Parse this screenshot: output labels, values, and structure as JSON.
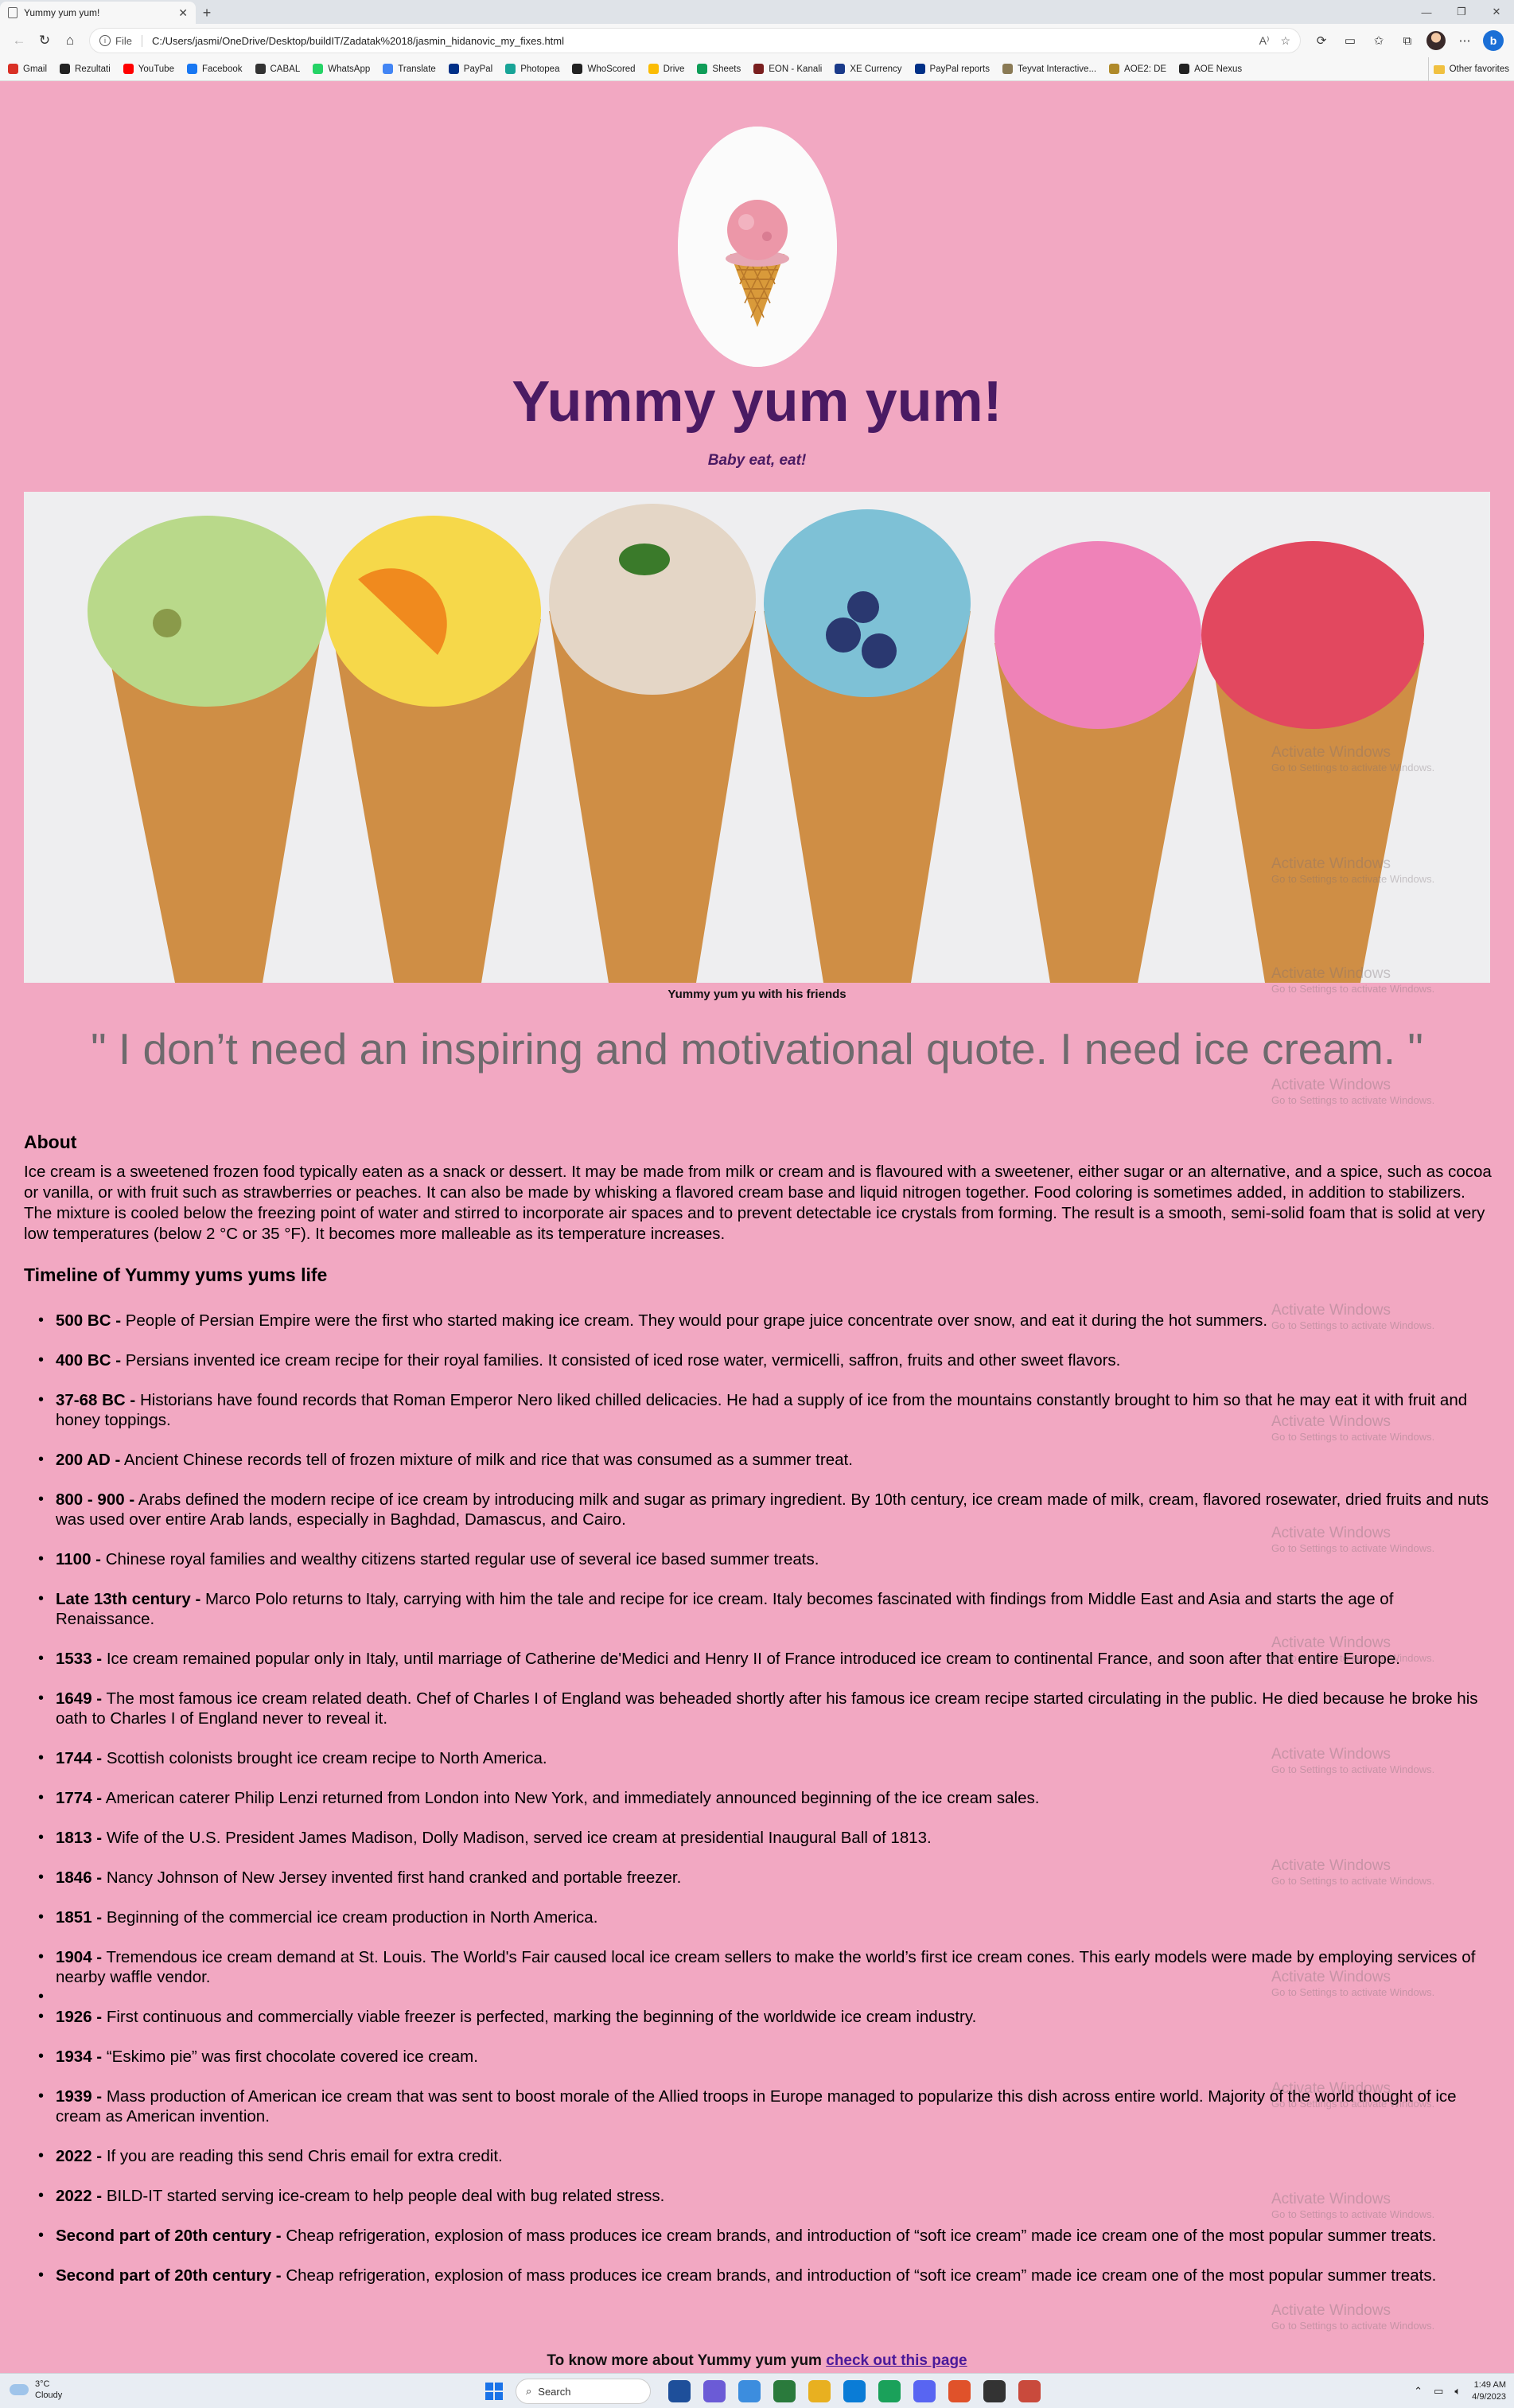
{
  "browser": {
    "tab_title": "Yummy yum yum!",
    "tab_close": "✕",
    "new_tab": "+",
    "window_controls": [
      "—",
      "❐",
      "✕"
    ],
    "address_scheme": "File",
    "address_url": "C:/Users/jasmi/OneDrive/Desktop/buildIT/Zadatak%2018/jasmin_hidanovic_my_fixes.html",
    "read_aloud": "A⁾",
    "bookmarks": [
      {
        "label": "Gmail",
        "color": "#d93025"
      },
      {
        "label": "Rezultati",
        "color": "#222222"
      },
      {
        "label": "YouTube",
        "color": "#ff0000"
      },
      {
        "label": "Facebook",
        "color": "#1877f2"
      },
      {
        "label": "CABAL",
        "color": "#333333"
      },
      {
        "label": "WhatsApp",
        "color": "#25d366"
      },
      {
        "label": "Translate",
        "color": "#4285f4"
      },
      {
        "label": "PayPal",
        "color": "#003087"
      },
      {
        "label": "Photopea",
        "color": "#18a497"
      },
      {
        "label": "WhoScored",
        "color": "#222222"
      },
      {
        "label": "Drive",
        "color": "#fbbc04"
      },
      {
        "label": "Sheets",
        "color": "#0f9d58"
      },
      {
        "label": "EON - Kanali",
        "color": "#7a1f1f"
      },
      {
        "label": "XE Currency",
        "color": "#1a3a8a"
      },
      {
        "label": "PayPal reports",
        "color": "#003087"
      },
      {
        "label": "Teyvat Interactive...",
        "color": "#8a7a55"
      },
      {
        "label": "AOE2: DE",
        "color": "#b08a2a"
      },
      {
        "label": "AOE Nexus",
        "color": "#222222"
      }
    ],
    "bookmarks_more": "›",
    "other_favorites": "Other favorites"
  },
  "page": {
    "title": "Yummy yum yum!",
    "tagline": "Baby eat, eat!",
    "image_caption": "Yummy yum yu with his friends",
    "quote": "\" I don’t need an inspiring and motivational quote. I need ice cream. \"",
    "about_heading": "About",
    "about_text": "Ice cream is a sweetened frozen food typically eaten as a snack or dessert. It may be made from milk or cream and is flavoured with a sweetener, either sugar or an alternative, and a spice, such as cocoa or vanilla, or with fruit such as strawberries or peaches. It can also be made by whisking a flavored cream base and liquid nitrogen together. Food coloring is sometimes added, in addition to stabilizers. The mixture is cooled below the freezing point of water and stirred to incorporate air spaces and to prevent detectable ice crystals from forming. The result is a smooth, semi-solid foam that is solid at very low temperatures (below 2 °C or 35 °F). It becomes more malleable as its temperature increases.",
    "timeline_heading": "Timeline of Yummy yums yums life",
    "timeline": [
      {
        "date": "500 BC -",
        "text": " People of Persian Empire were the first who started making ice cream. They would pour grape juice concentrate over snow, and eat it during the hot summers."
      },
      {
        "date": "400 BC -",
        "text": " Persians invented ice cream recipe for their royal families. It consisted of iced rose water, vermicelli, saffron, fruits and other sweet flavors."
      },
      {
        "date": "37-68 BC -",
        "text": " Historians have found records that Roman Emperor Nero liked chilled delicacies. He had a supply of ice from the mountains constantly brought to him so that he may eat it with fruit and honey toppings."
      },
      {
        "date": "200 AD -",
        "text": " Ancient Chinese records tell of frozen mixture of milk and rice that was consumed as a summer treat."
      },
      {
        "date": "800 - 900 -",
        "text": " Arabs defined the modern recipe of ice cream by introducing milk and sugar as primary ingredient. By 10th century, ice cream made of milk, cream, flavored rosewater, dried fruits and nuts was used over entire Arab lands, especially in Baghdad, Damascus, and Cairo."
      },
      {
        "date": "1100 -",
        "text": " Chinese royal families and wealthy citizens started regular use of several ice based summer treats."
      },
      {
        "date": "Late 13th century -",
        "text": " Marco Polo returns to Italy, carrying with him the tale and recipe for ice cream. Italy becomes fascinated with findings from Middle East and Asia and starts the age of Renaissance."
      },
      {
        "date": "1533 -",
        "text": " Ice cream remained popular only in Italy, until marriage of Catherine de'Medici and Henry II of France introduced ice cream to continental France, and soon after that entire Europe."
      },
      {
        "date": "1649 -",
        "text": " The most famous ice cream related death. Chef of Charles I of England was beheaded shortly after his famous ice cream recipe started circulating in the public. He died because he broke his oath to Charles I of England never to reveal it."
      },
      {
        "date": "1744 -",
        "text": " Scottish colonists brought ice cream recipe to North America."
      },
      {
        "date": "1774 -",
        "text": " American caterer Philip Lenzi returned from London into New York, and immediately announced beginning of the ice cream sales."
      },
      {
        "date": "1813 -",
        "text": " Wife of the U.S. President James Madison, Dolly Madison, served ice cream at presidential Inaugural Ball of 1813."
      },
      {
        "date": "1846 -",
        "text": " Nancy Johnson of New Jersey invented first hand cranked and portable freezer."
      },
      {
        "date": "1851 -",
        "text": " Beginning of the commercial ice cream production in North America."
      },
      {
        "date": "1904 -",
        "text": " Tremendous ice cream demand at St. Louis. The World's Fair caused local ice cream sellers to make the world’s first ice cream cones. This early models were made by employing services of nearby waffle vendor."
      },
      {
        "date": "",
        "text": ""
      },
      {
        "date": "1926 -",
        "text": " First continuous and commercially viable freezer is perfected, marking the beginning of the worldwide ice cream industry."
      },
      {
        "date": "1934 -",
        "text": " “Eskimo pie” was first chocolate covered ice cream."
      },
      {
        "date": "1939 -",
        "text": " Mass production of American ice cream that was sent to boost morale of the Allied troops in Europe managed to popularize this dish across entire world. Majority of the world thought of ice cream as American invention."
      },
      {
        "date": "2022 -",
        "text": " If you are reading this send Chris email for extra credit."
      },
      {
        "date": "2022 -",
        "text": " BILD-IT started serving ice-cream to help people deal with bug related stress."
      },
      {
        "date": "Second part of 20th century -",
        "text": " Cheap refrigeration, explosion of mass produces ice cream brands, and introduction of “soft ice cream” made ice cream one of the most popular summer treats."
      },
      {
        "date": "Second part of 20th century -",
        "text": " Cheap refrigeration, explosion of mass produces ice cream brands, and introduction of “soft ice cream” made ice cream one of the most popular summer treats."
      }
    ],
    "footer_text": "To know more about Yummy yum yum ",
    "footer_link": "check out this page"
  },
  "watermark": {
    "line1": "Activate Windows",
    "line2": "Go to Settings to activate Windows."
  },
  "taskbar": {
    "temperature": "3°C",
    "condition": "Cloudy",
    "search_placeholder": "Search",
    "time": "1:49 AM",
    "date": "4/9/2023",
    "app_colors": [
      "#1e4f9a",
      "#6b5bd6",
      "#3c8dde",
      "#2a7a3c",
      "#e8b020",
      "#0a7cd6",
      "#1aa15a",
      "#5865f2",
      "#e0522a",
      "#333333",
      "#c94a3c"
    ]
  },
  "colors": {
    "page_background": "#f2a8c2",
    "title": "#4a1a63",
    "quote": "#6e6a6d",
    "link": "#4a1a9a"
  }
}
